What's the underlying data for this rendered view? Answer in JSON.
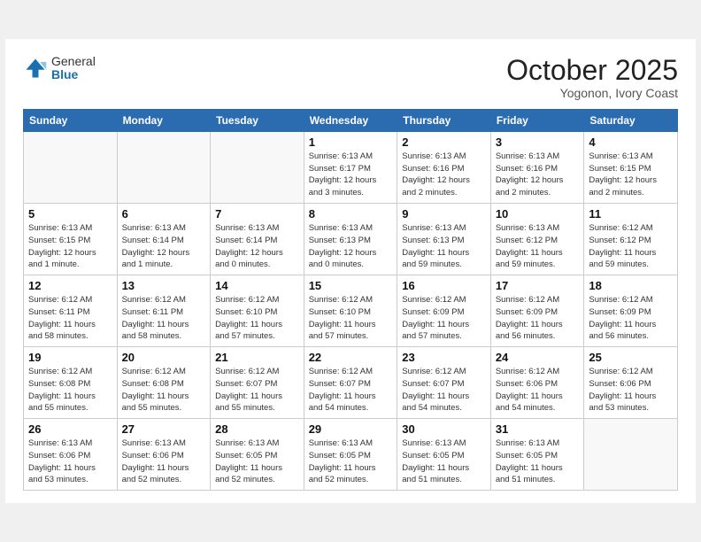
{
  "header": {
    "logo": {
      "general": "General",
      "blue": "Blue"
    },
    "title": "October 2025",
    "location": "Yogonon, Ivory Coast"
  },
  "weekdays": [
    "Sunday",
    "Monday",
    "Tuesday",
    "Wednesday",
    "Thursday",
    "Friday",
    "Saturday"
  ],
  "weeks": [
    [
      {
        "day": "",
        "info": ""
      },
      {
        "day": "",
        "info": ""
      },
      {
        "day": "",
        "info": ""
      },
      {
        "day": "1",
        "info": "Sunrise: 6:13 AM\nSunset: 6:17 PM\nDaylight: 12 hours\nand 3 minutes."
      },
      {
        "day": "2",
        "info": "Sunrise: 6:13 AM\nSunset: 6:16 PM\nDaylight: 12 hours\nand 2 minutes."
      },
      {
        "day": "3",
        "info": "Sunrise: 6:13 AM\nSunset: 6:16 PM\nDaylight: 12 hours\nand 2 minutes."
      },
      {
        "day": "4",
        "info": "Sunrise: 6:13 AM\nSunset: 6:15 PM\nDaylight: 12 hours\nand 2 minutes."
      }
    ],
    [
      {
        "day": "5",
        "info": "Sunrise: 6:13 AM\nSunset: 6:15 PM\nDaylight: 12 hours\nand 1 minute."
      },
      {
        "day": "6",
        "info": "Sunrise: 6:13 AM\nSunset: 6:14 PM\nDaylight: 12 hours\nand 1 minute."
      },
      {
        "day": "7",
        "info": "Sunrise: 6:13 AM\nSunset: 6:14 PM\nDaylight: 12 hours\nand 0 minutes."
      },
      {
        "day": "8",
        "info": "Sunrise: 6:13 AM\nSunset: 6:13 PM\nDaylight: 12 hours\nand 0 minutes."
      },
      {
        "day": "9",
        "info": "Sunrise: 6:13 AM\nSunset: 6:13 PM\nDaylight: 11 hours\nand 59 minutes."
      },
      {
        "day": "10",
        "info": "Sunrise: 6:13 AM\nSunset: 6:12 PM\nDaylight: 11 hours\nand 59 minutes."
      },
      {
        "day": "11",
        "info": "Sunrise: 6:12 AM\nSunset: 6:12 PM\nDaylight: 11 hours\nand 59 minutes."
      }
    ],
    [
      {
        "day": "12",
        "info": "Sunrise: 6:12 AM\nSunset: 6:11 PM\nDaylight: 11 hours\nand 58 minutes."
      },
      {
        "day": "13",
        "info": "Sunrise: 6:12 AM\nSunset: 6:11 PM\nDaylight: 11 hours\nand 58 minutes."
      },
      {
        "day": "14",
        "info": "Sunrise: 6:12 AM\nSunset: 6:10 PM\nDaylight: 11 hours\nand 57 minutes."
      },
      {
        "day": "15",
        "info": "Sunrise: 6:12 AM\nSunset: 6:10 PM\nDaylight: 11 hours\nand 57 minutes."
      },
      {
        "day": "16",
        "info": "Sunrise: 6:12 AM\nSunset: 6:09 PM\nDaylight: 11 hours\nand 57 minutes."
      },
      {
        "day": "17",
        "info": "Sunrise: 6:12 AM\nSunset: 6:09 PM\nDaylight: 11 hours\nand 56 minutes."
      },
      {
        "day": "18",
        "info": "Sunrise: 6:12 AM\nSunset: 6:09 PM\nDaylight: 11 hours\nand 56 minutes."
      }
    ],
    [
      {
        "day": "19",
        "info": "Sunrise: 6:12 AM\nSunset: 6:08 PM\nDaylight: 11 hours\nand 55 minutes."
      },
      {
        "day": "20",
        "info": "Sunrise: 6:12 AM\nSunset: 6:08 PM\nDaylight: 11 hours\nand 55 minutes."
      },
      {
        "day": "21",
        "info": "Sunrise: 6:12 AM\nSunset: 6:07 PM\nDaylight: 11 hours\nand 55 minutes."
      },
      {
        "day": "22",
        "info": "Sunrise: 6:12 AM\nSunset: 6:07 PM\nDaylight: 11 hours\nand 54 minutes."
      },
      {
        "day": "23",
        "info": "Sunrise: 6:12 AM\nSunset: 6:07 PM\nDaylight: 11 hours\nand 54 minutes."
      },
      {
        "day": "24",
        "info": "Sunrise: 6:12 AM\nSunset: 6:06 PM\nDaylight: 11 hours\nand 54 minutes."
      },
      {
        "day": "25",
        "info": "Sunrise: 6:12 AM\nSunset: 6:06 PM\nDaylight: 11 hours\nand 53 minutes."
      }
    ],
    [
      {
        "day": "26",
        "info": "Sunrise: 6:13 AM\nSunset: 6:06 PM\nDaylight: 11 hours\nand 53 minutes."
      },
      {
        "day": "27",
        "info": "Sunrise: 6:13 AM\nSunset: 6:06 PM\nDaylight: 11 hours\nand 52 minutes."
      },
      {
        "day": "28",
        "info": "Sunrise: 6:13 AM\nSunset: 6:05 PM\nDaylight: 11 hours\nand 52 minutes."
      },
      {
        "day": "29",
        "info": "Sunrise: 6:13 AM\nSunset: 6:05 PM\nDaylight: 11 hours\nand 52 minutes."
      },
      {
        "day": "30",
        "info": "Sunrise: 6:13 AM\nSunset: 6:05 PM\nDaylight: 11 hours\nand 51 minutes."
      },
      {
        "day": "31",
        "info": "Sunrise: 6:13 AM\nSunset: 6:05 PM\nDaylight: 11 hours\nand 51 minutes."
      },
      {
        "day": "",
        "info": ""
      }
    ]
  ]
}
